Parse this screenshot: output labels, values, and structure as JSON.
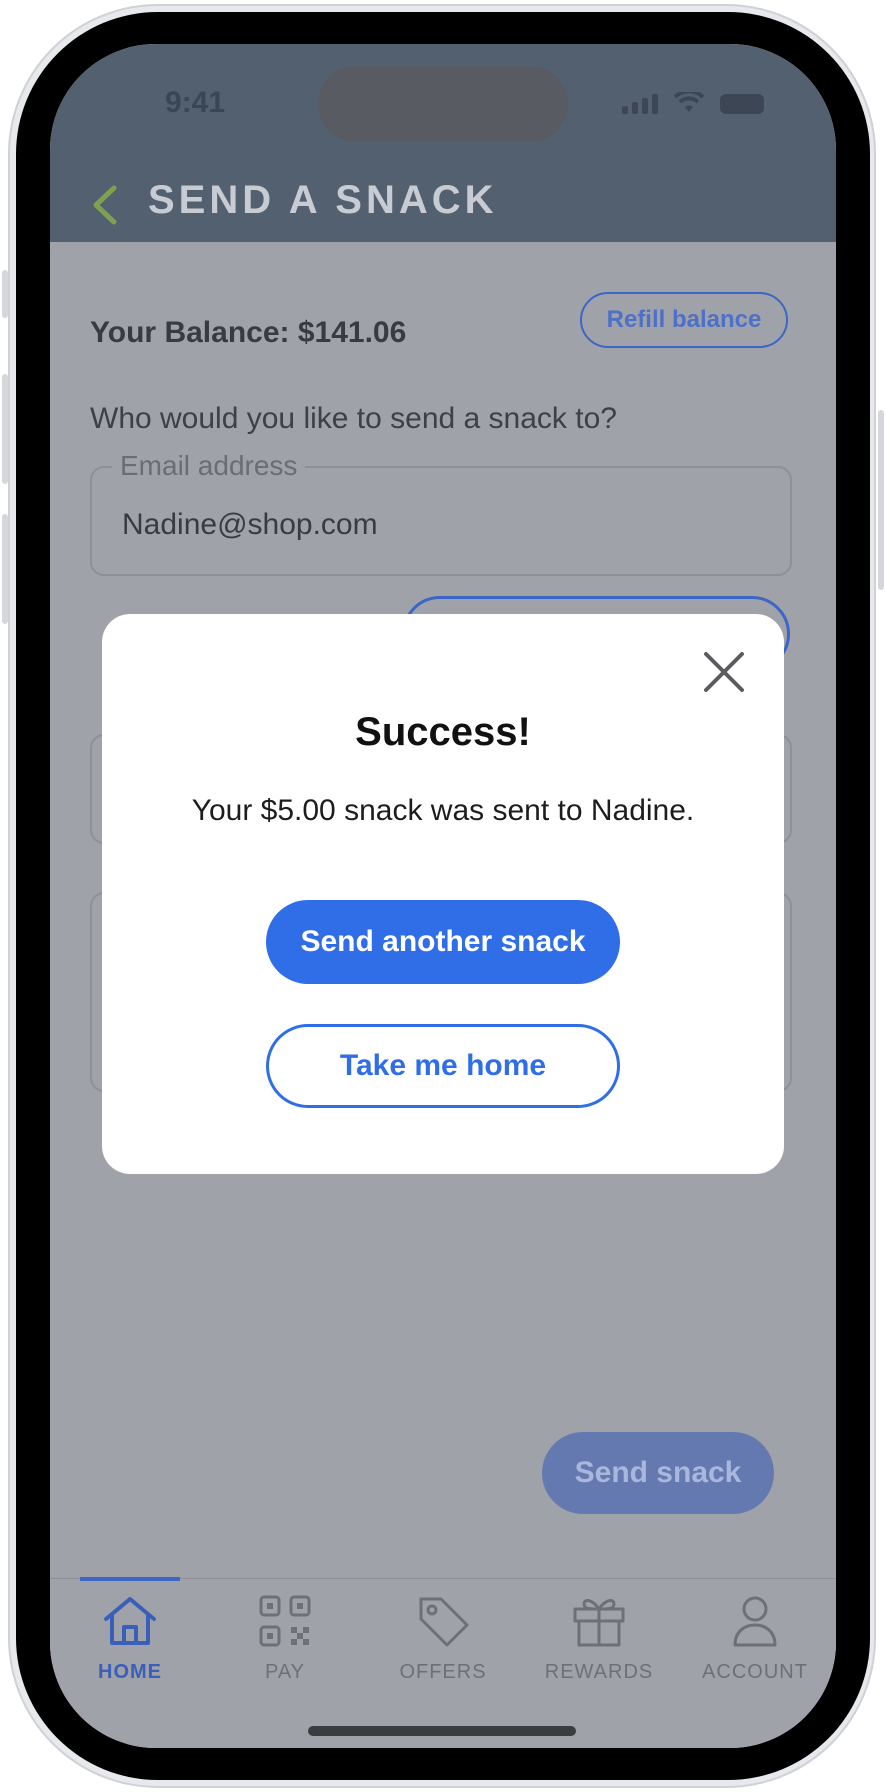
{
  "status_bar": {
    "time": "9:41"
  },
  "header": {
    "title": "SEND A SNACK"
  },
  "balance": {
    "label": "Your Balance: $141.06",
    "refill_label": "Refill balance"
  },
  "recipient": {
    "prompt": "Who would you like to send a snack to?",
    "email_label": "Email address",
    "email_value": "Nadine@shop.com"
  },
  "send_button_label": "Send snack",
  "modal": {
    "title": "Success!",
    "message": "Your $5.00 snack was sent to Nadine.",
    "primary_label": "Send another snack",
    "secondary_label": "Take me home"
  },
  "tabs": [
    {
      "label": "HOME",
      "icon": "home-icon",
      "active": true
    },
    {
      "label": "PAY",
      "icon": "qr-code-icon",
      "active": false
    },
    {
      "label": "OFFERS",
      "icon": "tag-icon",
      "active": false
    },
    {
      "label": "REWARDS",
      "icon": "gift-icon",
      "active": false
    },
    {
      "label": "ACCOUNT",
      "icon": "person-icon",
      "active": false
    }
  ],
  "colors": {
    "accent": "#2F6EE6",
    "header_bg": "#526070",
    "overlay_bg": "#A0A2A9",
    "back_chevron": "#7FA050"
  }
}
